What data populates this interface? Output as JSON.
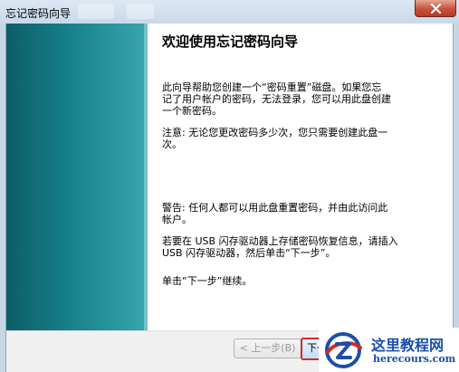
{
  "window": {
    "title": "忘记密码向导"
  },
  "content": {
    "heading": "欢迎使用忘记密码向导",
    "intro_lines": [
      "此向导帮助您创建一个“密码重置”磁盘。如果您忘",
      "记了用户帐户的密码，无法登录，您可以用此盘创建",
      "一个新密码。"
    ],
    "note_lines": [
      "注意: 无论您更改密码多少次，您只需要创建此盘一",
      "次。"
    ],
    "warning_lines": [
      "警告: 任何人都可以用此盘重置密码，并由此访问此",
      "帐户。"
    ],
    "usb_lines": [
      "若要在 USB 闪存驱动器上存储密码恢复信息，请插入",
      "USB 闪存驱动器，然后单击“下一步”。"
    ],
    "continue_text": "单击“下一步”继续。"
  },
  "footer": {
    "back_label": "< 上一步(B)",
    "next_label": "下一步"
  },
  "watermark": {
    "cn_text": "这里教程网",
    "url_text": "herecours.com"
  }
}
